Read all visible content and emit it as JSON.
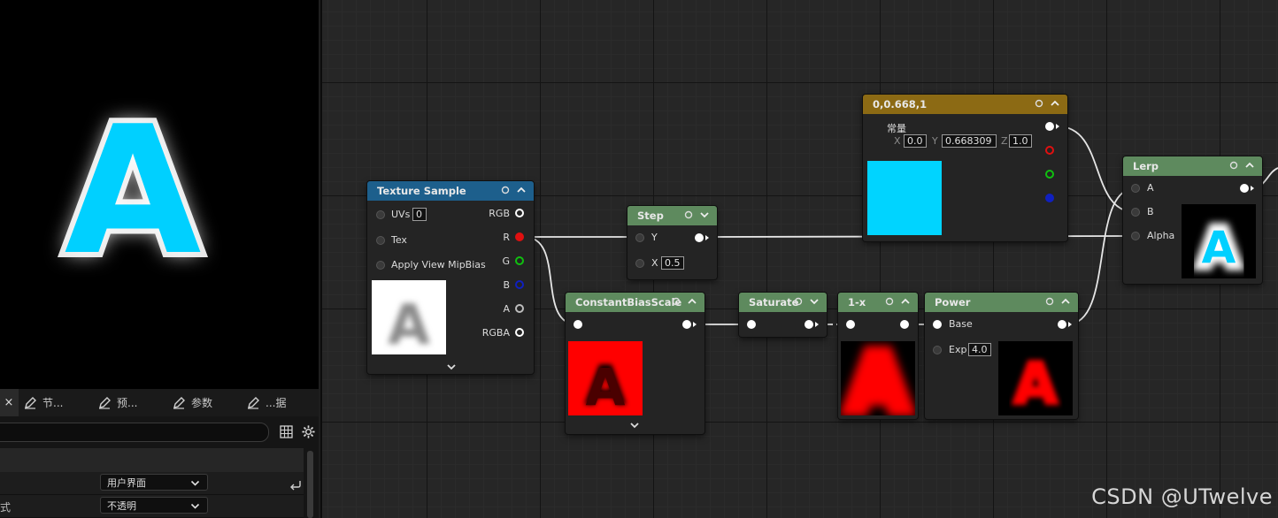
{
  "preview": {
    "letter": "A",
    "glyph_color": "#00d0ff"
  },
  "details": {
    "tabs": [
      {
        "label": "节..."
      },
      {
        "label": "预..."
      },
      {
        "label": "参数"
      },
      {
        "label": "...据"
      }
    ],
    "close_glyph": "×",
    "rows": [
      {
        "label": "",
        "value": "用户界面"
      },
      {
        "label": "式",
        "value": "不透明"
      }
    ]
  },
  "nodes": {
    "texture_sample": {
      "title": "Texture Sample",
      "header_color": "#1d5f8c",
      "inputs": [
        "UVs",
        "Tex",
        "Apply View MipBias"
      ],
      "uvs_value": "0",
      "outputs": [
        "RGB",
        "R",
        "G",
        "B",
        "A",
        "RGBA"
      ]
    },
    "step": {
      "title": "Step",
      "header_color": "#5e8a5e",
      "inputs": [
        "Y",
        "X"
      ],
      "x_value": "0.5"
    },
    "constant_bias_scale": {
      "title": "ConstantBiasScale",
      "header_color": "#5e8a5e"
    },
    "saturate": {
      "title": "Saturate",
      "header_color": "#5e8a5e"
    },
    "one_minus": {
      "title": "1-x",
      "header_color": "#5e8a5e"
    },
    "power": {
      "title": "Power",
      "header_color": "#5e8a5e",
      "inputs": [
        "Base",
        "Exp"
      ],
      "exp_value": "4.0"
    },
    "constant3": {
      "title": "0,0.668,1",
      "header_color": "#8c6a14",
      "label": "常量",
      "x_label": "X",
      "x_value": "0.0",
      "y_label": "Y",
      "y_value": "0.668309",
      "z_label": "Z",
      "z_value": "1.0",
      "swatch_color": "#00d4ff"
    },
    "lerp": {
      "title": "Lerp",
      "header_color": "#5e8a5e",
      "inputs": [
        "A",
        "B",
        "Alpha"
      ]
    }
  },
  "pin_colors": {
    "red": "#e01010",
    "green": "#10c010",
    "blue": "#1020c0",
    "white": "#ffffff"
  },
  "watermark": "CSDN @UTwelve"
}
